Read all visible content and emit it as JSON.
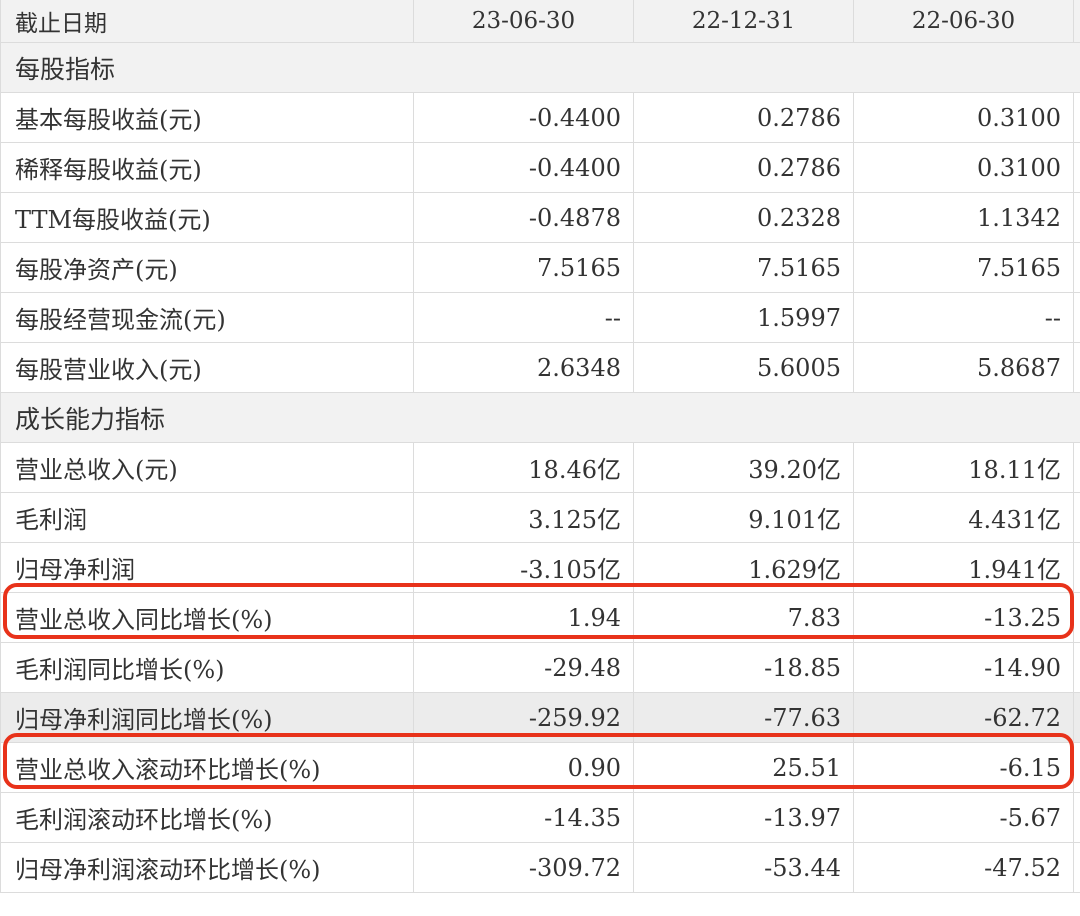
{
  "table": {
    "header": [
      "截止日期",
      "23-06-30",
      "22-12-31",
      "22-06-30"
    ],
    "rows": [
      {
        "type": "section",
        "label": "每股指标"
      },
      {
        "type": "data",
        "label": "基本每股收益(元)",
        "values": [
          "-0.4400",
          "0.2786",
          "0.3100"
        ]
      },
      {
        "type": "data",
        "label": "稀释每股收益(元)",
        "values": [
          "-0.4400",
          "0.2786",
          "0.3100"
        ]
      },
      {
        "type": "data",
        "label": "TTM每股收益(元)",
        "values": [
          "-0.4878",
          "0.2328",
          "1.1342"
        ]
      },
      {
        "type": "data",
        "label": "每股净资产(元)",
        "values": [
          "7.5165",
          "7.5165",
          "7.5165"
        ]
      },
      {
        "type": "data",
        "label": "每股经营现金流(元)",
        "values": [
          "--",
          "1.5997",
          "--"
        ]
      },
      {
        "type": "data",
        "label": "每股营业收入(元)",
        "values": [
          "2.6348",
          "5.6005",
          "5.8687"
        ]
      },
      {
        "type": "section",
        "label": "成长能力指标"
      },
      {
        "type": "data",
        "label": "营业总收入(元)",
        "values": [
          "18.46亿",
          "39.20亿",
          "18.11亿"
        ]
      },
      {
        "type": "data",
        "label": "毛利润",
        "values": [
          "3.125亿",
          "9.101亿",
          "4.431亿"
        ]
      },
      {
        "type": "data",
        "label": "归母净利润",
        "values": [
          "-3.105亿",
          "1.629亿",
          "1.941亿"
        ],
        "highlight": true
      },
      {
        "type": "data",
        "label": "营业总收入同比增长(%)",
        "values": [
          "1.94",
          "7.83",
          "-13.25"
        ]
      },
      {
        "type": "data",
        "label": "毛利润同比增长(%)",
        "values": [
          "-29.48",
          "-18.85",
          "-14.90"
        ]
      },
      {
        "type": "data",
        "label": "归母净利润同比增长(%)",
        "values": [
          "-259.92",
          "-77.63",
          "-62.72"
        ],
        "highlight": true,
        "shaded": true
      },
      {
        "type": "data",
        "label": "营业总收入滚动环比增长(%)",
        "values": [
          "0.90",
          "25.51",
          "-6.15"
        ]
      },
      {
        "type": "data",
        "label": "毛利润滚动环比增长(%)",
        "values": [
          "-14.35",
          "-13.97",
          "-5.67"
        ]
      },
      {
        "type": "data",
        "label": "归母净利润滚动环比增长(%)",
        "values": [
          "-309.72",
          "-53.44",
          "-47.52"
        ]
      }
    ]
  },
  "colors": {
    "highlight_border": "#e8321a",
    "header_bg": "#f2f2f2",
    "grid_line": "#dcdcdc",
    "text": "#333333"
  }
}
